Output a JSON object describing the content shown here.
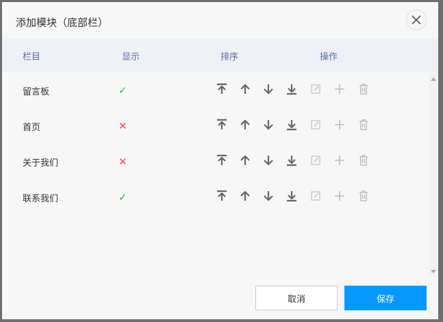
{
  "dialog": {
    "title": "添加模块（底部栏）"
  },
  "table": {
    "headers": {
      "column": "栏目",
      "show": "显示",
      "order": "排序",
      "actions": "操作"
    },
    "rows": [
      {
        "name": "留言板",
        "visible": true
      },
      {
        "name": "首页",
        "visible": false
      },
      {
        "name": "关于我们",
        "visible": false
      },
      {
        "name": "联系我们",
        "visible": true
      }
    ]
  },
  "symbols": {
    "check": "✓",
    "cross": "✕"
  },
  "colors": {
    "check": "#19c13a",
    "cross": "#f24b4b",
    "primary": "#0599ff"
  },
  "footer": {
    "cancel": "取消",
    "save": "保存"
  }
}
